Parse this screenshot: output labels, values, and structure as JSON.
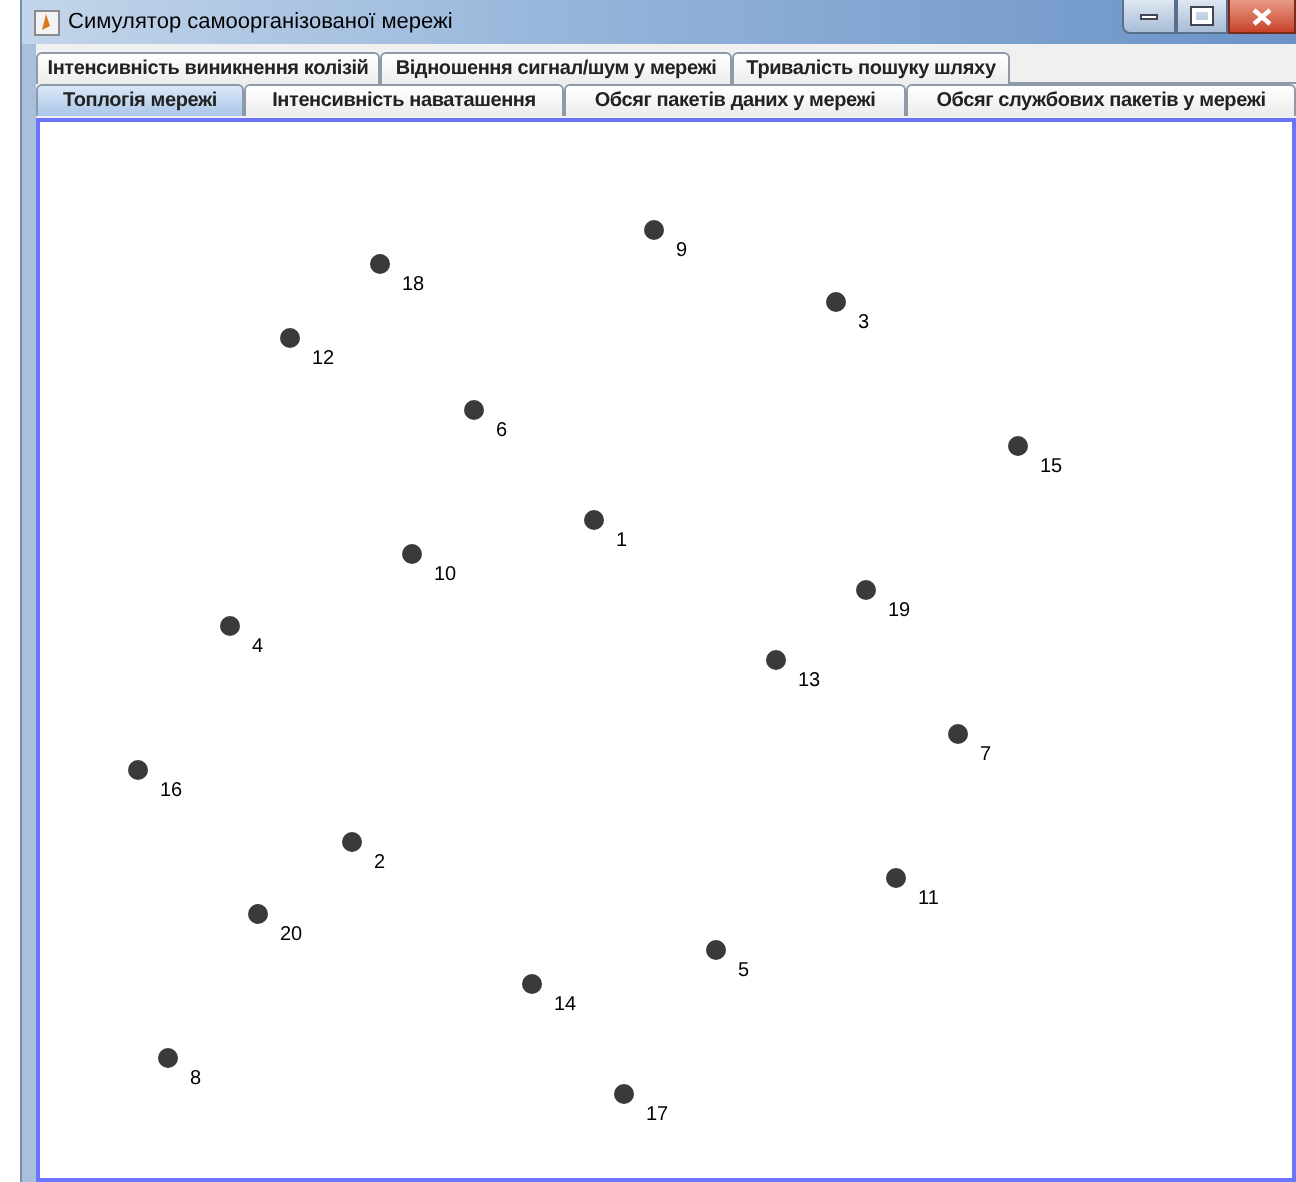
{
  "window": {
    "title": "Симулятор самоорганізованої мережі"
  },
  "tab_rows": [
    [
      {
        "label": "Інтенсивність виникнення колізій",
        "selected": false
      },
      {
        "label": "Відношення сигнал/шум у мережі",
        "selected": false
      },
      {
        "label": "Тривалість пошуку шляху",
        "selected": false
      }
    ],
    [
      {
        "label": "Топлогія мережі",
        "selected": true
      },
      {
        "label": "Інтенсивність наваташення",
        "selected": false
      },
      {
        "label": "Обсяг пакетів даних у мережі",
        "selected": false
      },
      {
        "label": "Обсяг службових пакетів у мережі",
        "selected": false
      }
    ]
  ],
  "nodes": [
    {
      "label": "9"
    },
    {
      "label": "18"
    },
    {
      "label": "3"
    },
    {
      "label": "12"
    },
    {
      "label": "6"
    },
    {
      "label": "15"
    },
    {
      "label": "1"
    },
    {
      "label": "10"
    },
    {
      "label": "19"
    },
    {
      "label": "4"
    },
    {
      "label": "13"
    },
    {
      "label": "7"
    },
    {
      "label": "16"
    },
    {
      "label": "2"
    },
    {
      "label": "11"
    },
    {
      "label": "20"
    },
    {
      "label": "5"
    },
    {
      "label": "14"
    },
    {
      "label": "8"
    },
    {
      "label": "17"
    }
  ]
}
